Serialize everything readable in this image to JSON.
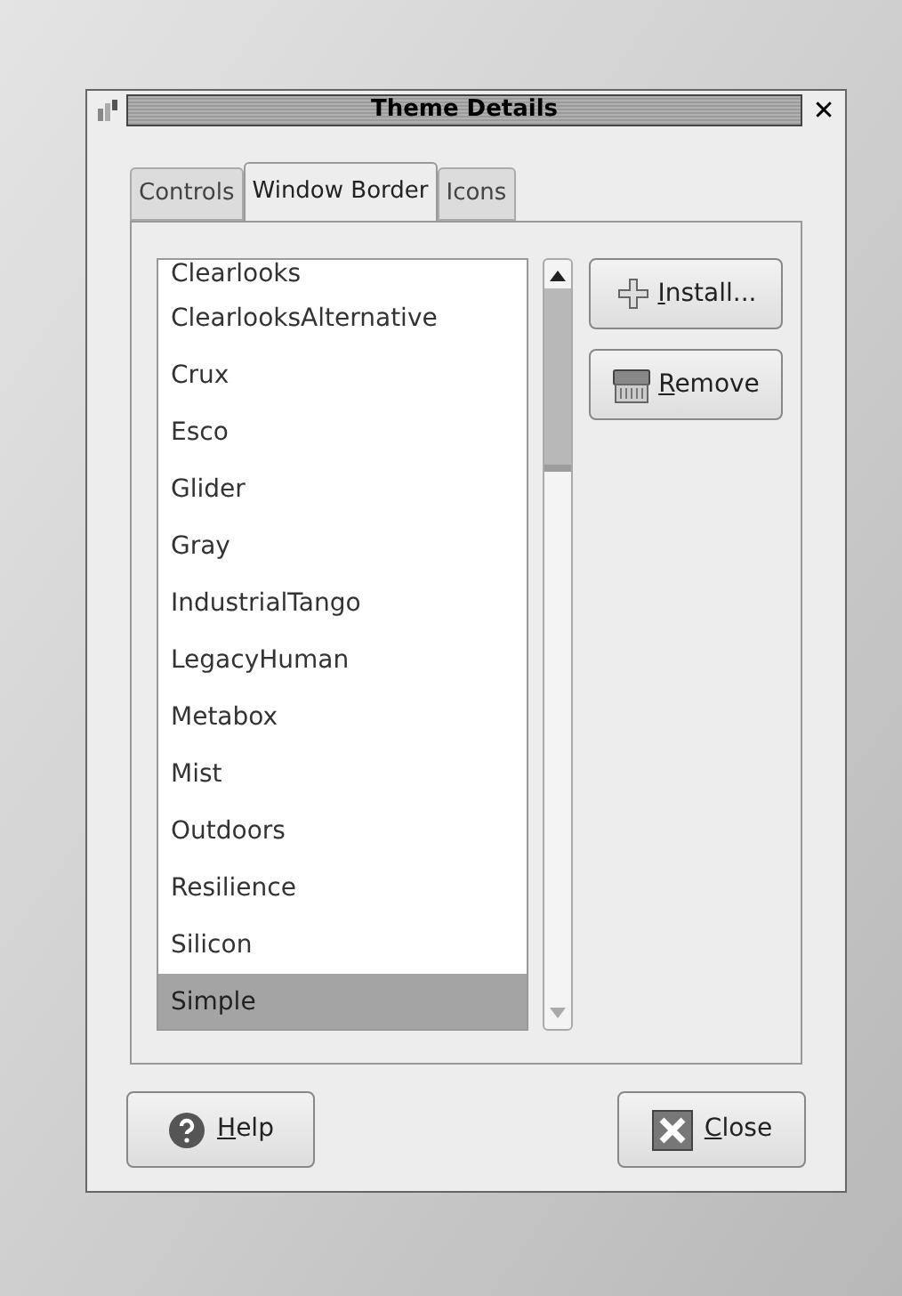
{
  "window": {
    "title": "Theme Details",
    "close": "✕"
  },
  "tabs": [
    {
      "label": "Controls",
      "selected": false
    },
    {
      "label": "Window Border",
      "selected": true
    },
    {
      "label": "Icons",
      "selected": false
    }
  ],
  "themes": [
    {
      "name": "Clearlooks",
      "selected": false
    },
    {
      "name": "ClearlooksAlternative",
      "selected": false
    },
    {
      "name": "Crux",
      "selected": false
    },
    {
      "name": "Esco",
      "selected": false
    },
    {
      "name": "Glider",
      "selected": false
    },
    {
      "name": "Gray",
      "selected": false
    },
    {
      "name": "IndustrialTango",
      "selected": false
    },
    {
      "name": "LegacyHuman",
      "selected": false
    },
    {
      "name": "Metabox",
      "selected": false
    },
    {
      "name": "Mist",
      "selected": false
    },
    {
      "name": "Outdoors",
      "selected": false
    },
    {
      "name": "Resilience",
      "selected": false
    },
    {
      "name": "Silicon",
      "selected": false
    },
    {
      "name": "Simple",
      "selected": true
    }
  ],
  "side_buttons": [
    {
      "kind": "install",
      "label": "Install..."
    },
    {
      "kind": "remove",
      "label": "Remove"
    }
  ],
  "footer_buttons": [
    {
      "kind": "help",
      "label": "Help"
    },
    {
      "kind": "close",
      "label": "Close"
    }
  ]
}
